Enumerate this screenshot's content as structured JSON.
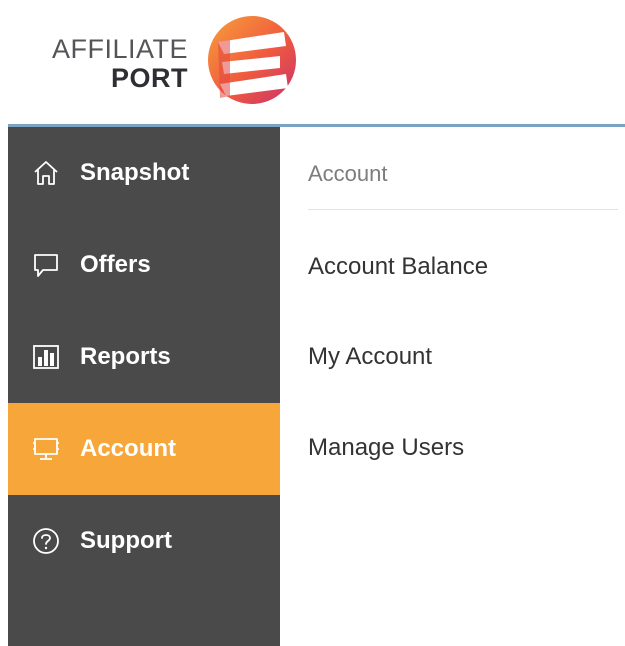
{
  "brand": {
    "name_line1": "AFFILIATE",
    "name_line2": "PORT",
    "logo_icon": "affiliate-port-logo-mark",
    "colors": {
      "gradient_start": "#f58a2a",
      "gradient_end": "#d8336b"
    }
  },
  "sidebar": {
    "background": "#4a4a4a",
    "active_color": "#f7a63a",
    "items": [
      {
        "label": "Snapshot",
        "icon": "home-icon",
        "active": false
      },
      {
        "label": "Offers",
        "icon": "speech-bubble-icon",
        "active": false
      },
      {
        "label": "Reports",
        "icon": "bar-chart-icon",
        "active": false
      },
      {
        "label": "Account",
        "icon": "monitor-icon",
        "active": true
      },
      {
        "label": "Support",
        "icon": "help-circle-icon",
        "active": false
      }
    ]
  },
  "main": {
    "section_title": "Account",
    "links": [
      {
        "label": "Account Balance"
      },
      {
        "label": "My Account"
      },
      {
        "label": "Manage Users"
      }
    ]
  }
}
